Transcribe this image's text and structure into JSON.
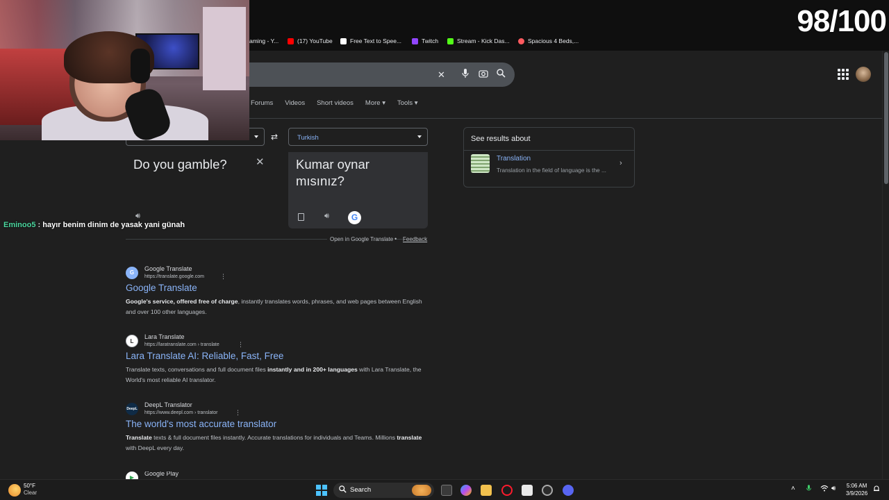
{
  "stream_overlay": {
    "score": "98/100",
    "chat": {
      "username": "Eminoo5",
      "separator": ":",
      "message": "hayır benim dinim de yasak yani günah"
    }
  },
  "bookmarks": [
    {
      "label": "aming - Y...",
      "color": "#ff0000"
    },
    {
      "label": "(17) YouTube",
      "color": "#ff0000"
    },
    {
      "label": "Free Text to Spee...",
      "color": "#ffffff"
    },
    {
      "label": "Twitch",
      "color": "#9146ff"
    },
    {
      "label": "Stream - Kick Das...",
      "color": "#53fc18"
    },
    {
      "label": "Spacious 4 Beds,...",
      "color": "#ff5a5f"
    }
  ],
  "search": {
    "clear_icon": "close-icon",
    "voice_icon": "microphone-icon",
    "lens_icon": "camera-icon",
    "search_icon": "search-icon"
  },
  "nav_tabs": [
    "Forums",
    "Videos",
    "Short videos",
    "More ▾",
    "Tools ▾"
  ],
  "translate": {
    "target_language": "Turkish",
    "source_text": "Do you gamble?",
    "translated_text": "Kumar oynar mısınız?",
    "g_badge": "G",
    "open_link": "Open in Google Translate",
    "dot": "•",
    "feedback": "Feedback"
  },
  "results": [
    {
      "site": "Google Translate",
      "url": "https://translate.google.com",
      "title": "Google Translate",
      "snippet_bold": "Google's service, offered free of charge",
      "snippet_rest": ", instantly translates words, phrases, and web pages between English and over 100 other languages."
    },
    {
      "site": "Lara Translate",
      "url": "https://laratranslate.com › translate",
      "title": "Lara Translate AI: Reliable, Fast, Free",
      "snippet_pre": "Translate texts, conversations and full document files ",
      "snippet_bold": "instantly and in 200+ languages",
      "snippet_rest": " with Lara Translate, the World's most reliable AI translator."
    },
    {
      "site": "DeepL Translator",
      "url": "https://www.deepl.com › translator",
      "title": "The world's most accurate translator",
      "snippet_bold": "Translate",
      "snippet_mid": " texts & full document files instantly. Accurate translations for individuals and Teams. Millions ",
      "snippet_bold2": "translate",
      "snippet_rest": " with DeepL every day."
    },
    {
      "site": "Google Play"
    }
  ],
  "knowledge_panel": {
    "heading": "See results about",
    "item_title": "Translation",
    "item_desc": "Translation in the field of language is the ..."
  },
  "taskbar": {
    "weather_temp": "50°F",
    "weather_desc": "Clear",
    "search_label": "Search",
    "time": "5:06 AM",
    "date": "3/9/2026"
  }
}
